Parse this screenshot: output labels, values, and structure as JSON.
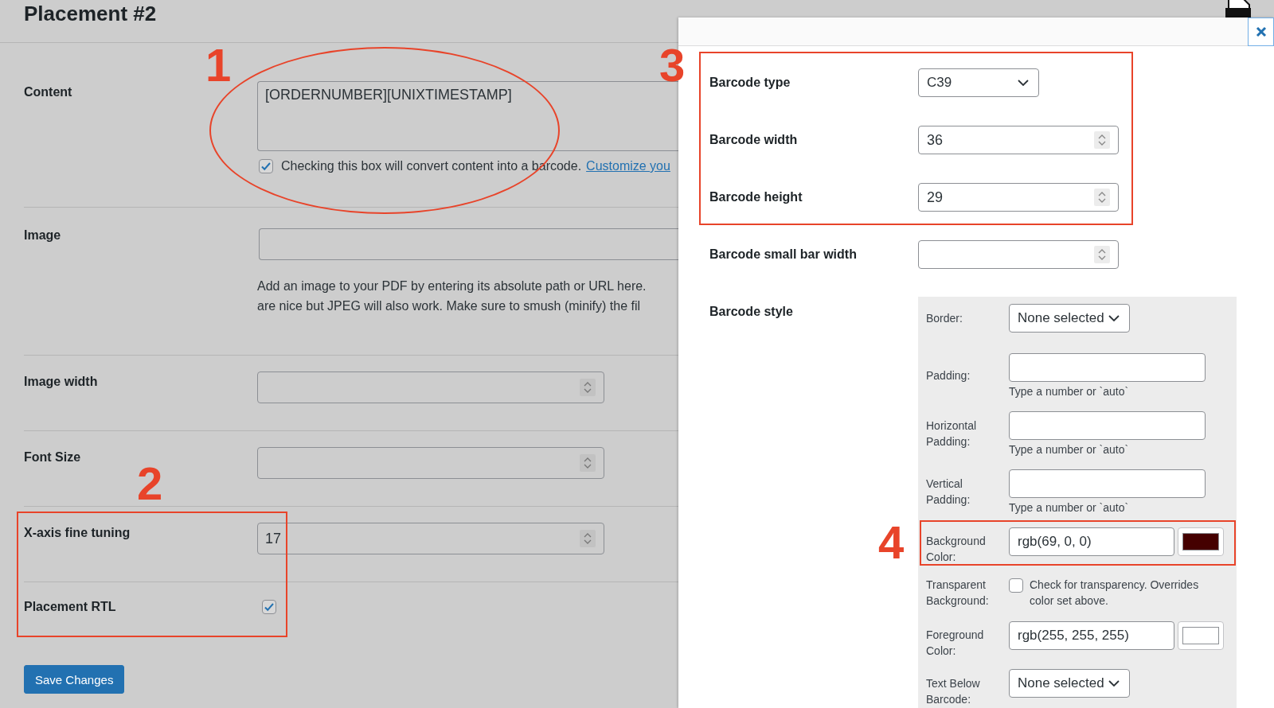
{
  "page": {
    "title": "Placement #2",
    "fields": [
      {
        "kind": "textarea",
        "label": "Content",
        "value": "[ORDERNUMBER][UNIXTIMESTAMP]",
        "checked": true,
        "text": "Checking this box will convert content into a barcode.",
        "link": "Customize you"
      },
      {
        "kind": "text",
        "label": "Image",
        "description_lines": [
          "Add an image to your PDF by entering its absolute path or URL here.",
          "are nice but JPEG will also work. Make sure to smush (minify) the fil"
        ]
      },
      {
        "kind": "number",
        "label": "Image width"
      },
      {
        "kind": "number",
        "label": "Font Size"
      },
      {
        "kind": "number",
        "label": "X-axis fine tuning",
        "value": "17"
      },
      {
        "kind": "checkbox",
        "label": "Placement RTL",
        "checked": true
      }
    ],
    "save_button": "Save Changes"
  },
  "panel": {
    "fields": [
      {
        "kind": "select",
        "label": "Barcode type",
        "value": "C39"
      },
      {
        "kind": "number",
        "label": "Barcode width",
        "value": "36"
      },
      {
        "kind": "number",
        "label": "Barcode height",
        "value": "29"
      },
      {
        "kind": "number",
        "label": "Barcode small bar width"
      },
      {
        "kind": "style",
        "label": "Barcode style"
      }
    ],
    "style": [
      {
        "kind": "select",
        "label": "Border:",
        "value": "None selected"
      },
      {
        "kind": "text",
        "label": "Padding:",
        "hint": "Type a number or `auto`"
      },
      {
        "kind": "text",
        "label": "Horizontal Padding:",
        "hint": "Type a number or `auto`"
      },
      {
        "kind": "text",
        "label": "Vertical Padding:",
        "hint": "Type a number or `auto`"
      },
      {
        "kind": "color",
        "label": "Background Color:",
        "value": "rgb(69, 0, 0)",
        "color": "#450000"
      },
      {
        "kind": "checkbox",
        "label": "Transparent Background:",
        "checked": false,
        "text": "Check for transparency. Overrides color set above."
      },
      {
        "kind": "color",
        "label": "Foreground Color:",
        "value": "rgb(255, 255, 255)",
        "color": "#ffffff"
      },
      {
        "kind": "select",
        "label": "Text Below Barcode:",
        "value": "None selected"
      }
    ]
  },
  "annotations": [
    {
      "kind": "ellipse",
      "number": "1"
    },
    {
      "kind": "box",
      "number": "2"
    },
    {
      "kind": "box",
      "number": "3"
    },
    {
      "kind": "box",
      "number": "4"
    }
  ]
}
